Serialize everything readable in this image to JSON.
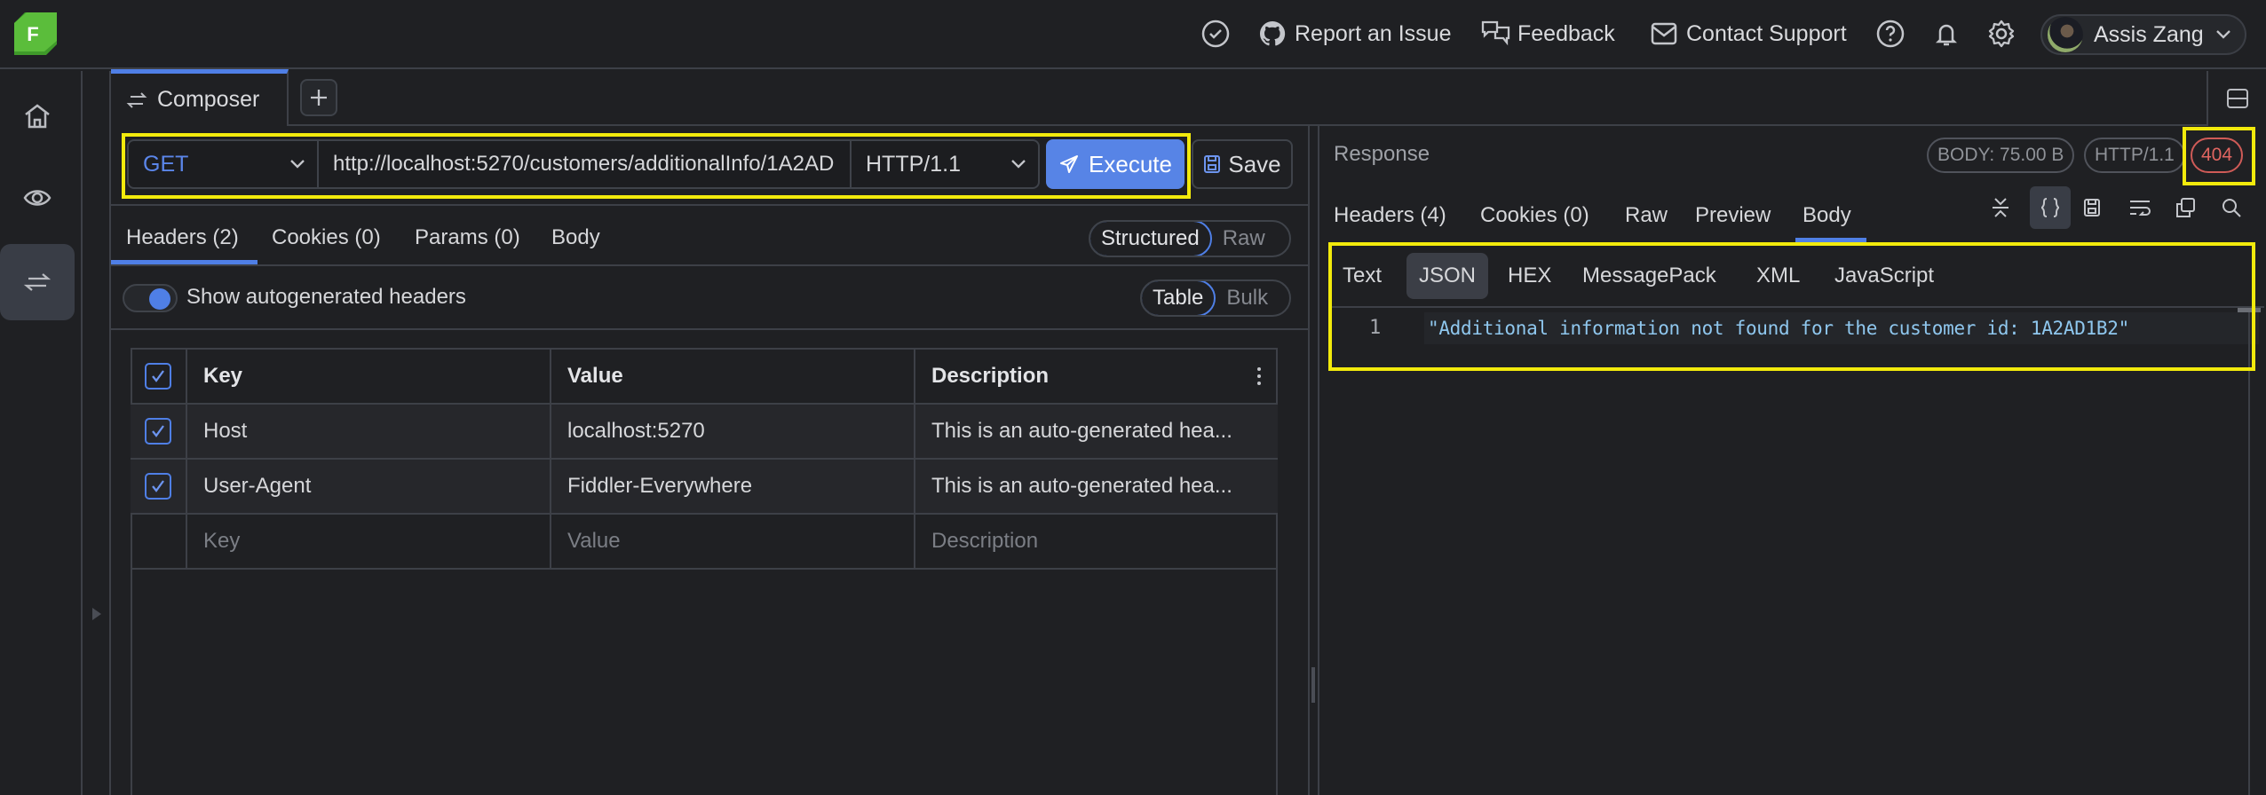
{
  "topbar": {
    "logo_letter": "F",
    "items": [
      {
        "label": "",
        "icon": "check-circle-icon"
      },
      {
        "label": "Report an Issue",
        "icon": "github-icon"
      },
      {
        "label": "Feedback",
        "icon": "chat-bubbles-icon"
      },
      {
        "label": "Contact Support",
        "icon": "mail-icon"
      }
    ],
    "user_name": "Assis Zang"
  },
  "sidebar": {
    "items": [
      {
        "name": "home",
        "icon": "home-icon",
        "active": false
      },
      {
        "name": "live-traffic",
        "icon": "eye-icon",
        "active": false
      },
      {
        "name": "composer",
        "icon": "arrows-exchange-icon",
        "active": true
      }
    ]
  },
  "tabs": {
    "composer_label": "Composer",
    "add_label": "+"
  },
  "request": {
    "method": "GET",
    "url": "http://localhost:5270/customers/additionalInfo/1A2AD",
    "protocol": "HTTP/1.1",
    "execute_label": "Execute",
    "save_label": "Save",
    "tabs": [
      "Headers (2)",
      "Cookies (0)",
      "Params (0)",
      "Body"
    ],
    "active_tab": "Headers (2)",
    "view_modes": [
      "Structured",
      "Raw"
    ],
    "active_view_mode": "Structured",
    "autogen_label": "Show autogenerated headers",
    "autogen_on": true,
    "edit_modes": [
      "Table",
      "Bulk"
    ],
    "active_edit_mode": "Table",
    "table": {
      "columns": [
        "Key",
        "Value",
        "Description"
      ],
      "rows": [
        {
          "checked": true,
          "key": "Host",
          "value": "localhost:5270",
          "description": "This is an auto-generated hea..."
        },
        {
          "checked": true,
          "key": "User-Agent",
          "value": "Fiddler-Everywhere",
          "description": "This is an auto-generated hea..."
        }
      ],
      "placeholder": {
        "key": "Key",
        "value": "Value",
        "description": "Description"
      }
    }
  },
  "response": {
    "title": "Response",
    "body_size": "BODY: 75.00 B",
    "protocol": "HTTP/1.1",
    "status": "404",
    "tabs": [
      "Headers (4)",
      "Cookies (0)",
      "Raw",
      "Preview",
      "Body"
    ],
    "active_tab": "Body",
    "formats": [
      "Text",
      "JSON",
      "HEX",
      "MessagePack",
      "XML",
      "JavaScript"
    ],
    "active_format": "JSON",
    "lines": [
      {
        "no": "1",
        "text": "\"Additional information not found for the customer id: 1A2AD1B2\""
      }
    ]
  },
  "colors": {
    "accent": "#4f7fe6",
    "status_error": "#e06560",
    "highlight": "#f2ea0c",
    "logo_green": "#5bbd3b"
  }
}
